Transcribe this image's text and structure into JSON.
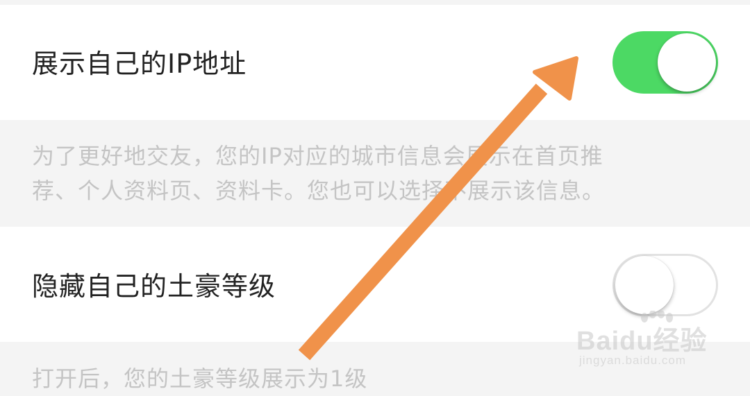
{
  "settings": [
    {
      "label": "展示自己的IP地址",
      "enabled": true,
      "description_lines": [
        "为了更好地交友，您的IP对应的城市信息会展示在首页推",
        "荐、个人资料页、资料卡。您也可以选择不展示该信息。"
      ]
    },
    {
      "label": "隐藏自己的土豪等级",
      "enabled": false,
      "description_lines": [
        "打开后，您的土豪等级展示为1级"
      ]
    }
  ],
  "colors": {
    "toggle_on": "#4cd964",
    "toggle_off_border": "#e2e2e2",
    "annotation_arrow": "#f0924a"
  },
  "watermark": {
    "brand": "Baidu经验",
    "url": "jingyan.baidu.com"
  }
}
